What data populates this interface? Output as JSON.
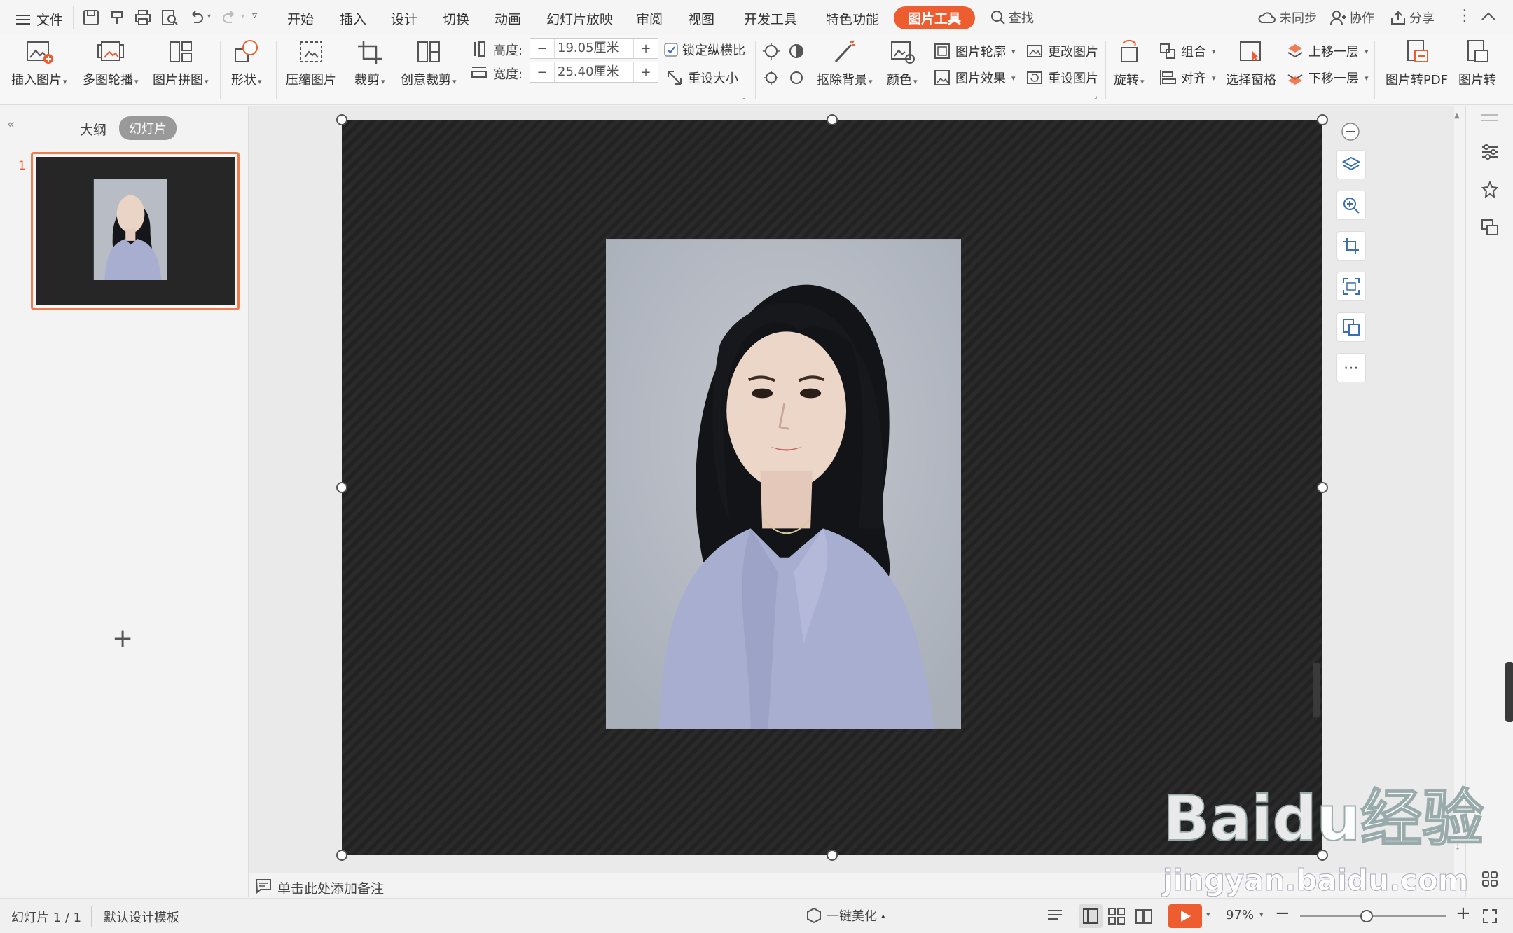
{
  "menubar": {
    "file_label": "文件",
    "tabs": [
      "开始",
      "插入",
      "设计",
      "切换",
      "动画",
      "幻灯片放映",
      "审阅",
      "视图",
      "开发工具",
      "特色功能"
    ],
    "active_tab": "图片工具",
    "search_label": "查找",
    "sync_label": "未同步",
    "collab_label": "协作",
    "share_label": "分享"
  },
  "ribbon": {
    "insert_picture": "插入图片",
    "multi_carousel": "多图轮播",
    "picture_collage": "图片拼图",
    "shape": "形状",
    "compress_picture": "压缩图片",
    "crop": "裁剪",
    "creative_crop": "创意裁剪",
    "height_label": "高度:",
    "height_value": "19.05厘米",
    "width_label": "宽度:",
    "width_value": "25.40厘米",
    "lock_ratio": "锁定纵横比",
    "reset_size": "重设大小",
    "remove_bg": "抠除背景",
    "color": "颜色",
    "picture_outline": "图片轮廓",
    "picture_effect": "图片效果",
    "change_picture": "更改图片",
    "reset_picture": "重设图片",
    "rotate": "旋转",
    "group": "组合",
    "align": "对齐",
    "selection_pane": "选择窗格",
    "bring_forward": "上移一层",
    "send_backward": "下移一层",
    "to_pdf": "图片转PDF",
    "to_more": "图片转"
  },
  "leftpanel": {
    "outline_tab": "大纲",
    "slides_tab": "幻灯片",
    "slide_number": "1"
  },
  "notes": {
    "placeholder": "单击此处添加备注"
  },
  "statusbar": {
    "slide_info": "幻灯片 1 / 1",
    "template": "默认设计模板",
    "beautify": "一键美化",
    "zoom": "97%"
  },
  "watermark": {
    "brand": "Baidu经验",
    "url": "jingyan.baidu.com"
  },
  "colors": {
    "accent": "#ee5d2f",
    "slide_bg": "#262626",
    "photo_bg": "#b7bcc5",
    "shirt": "#a8aed0"
  }
}
